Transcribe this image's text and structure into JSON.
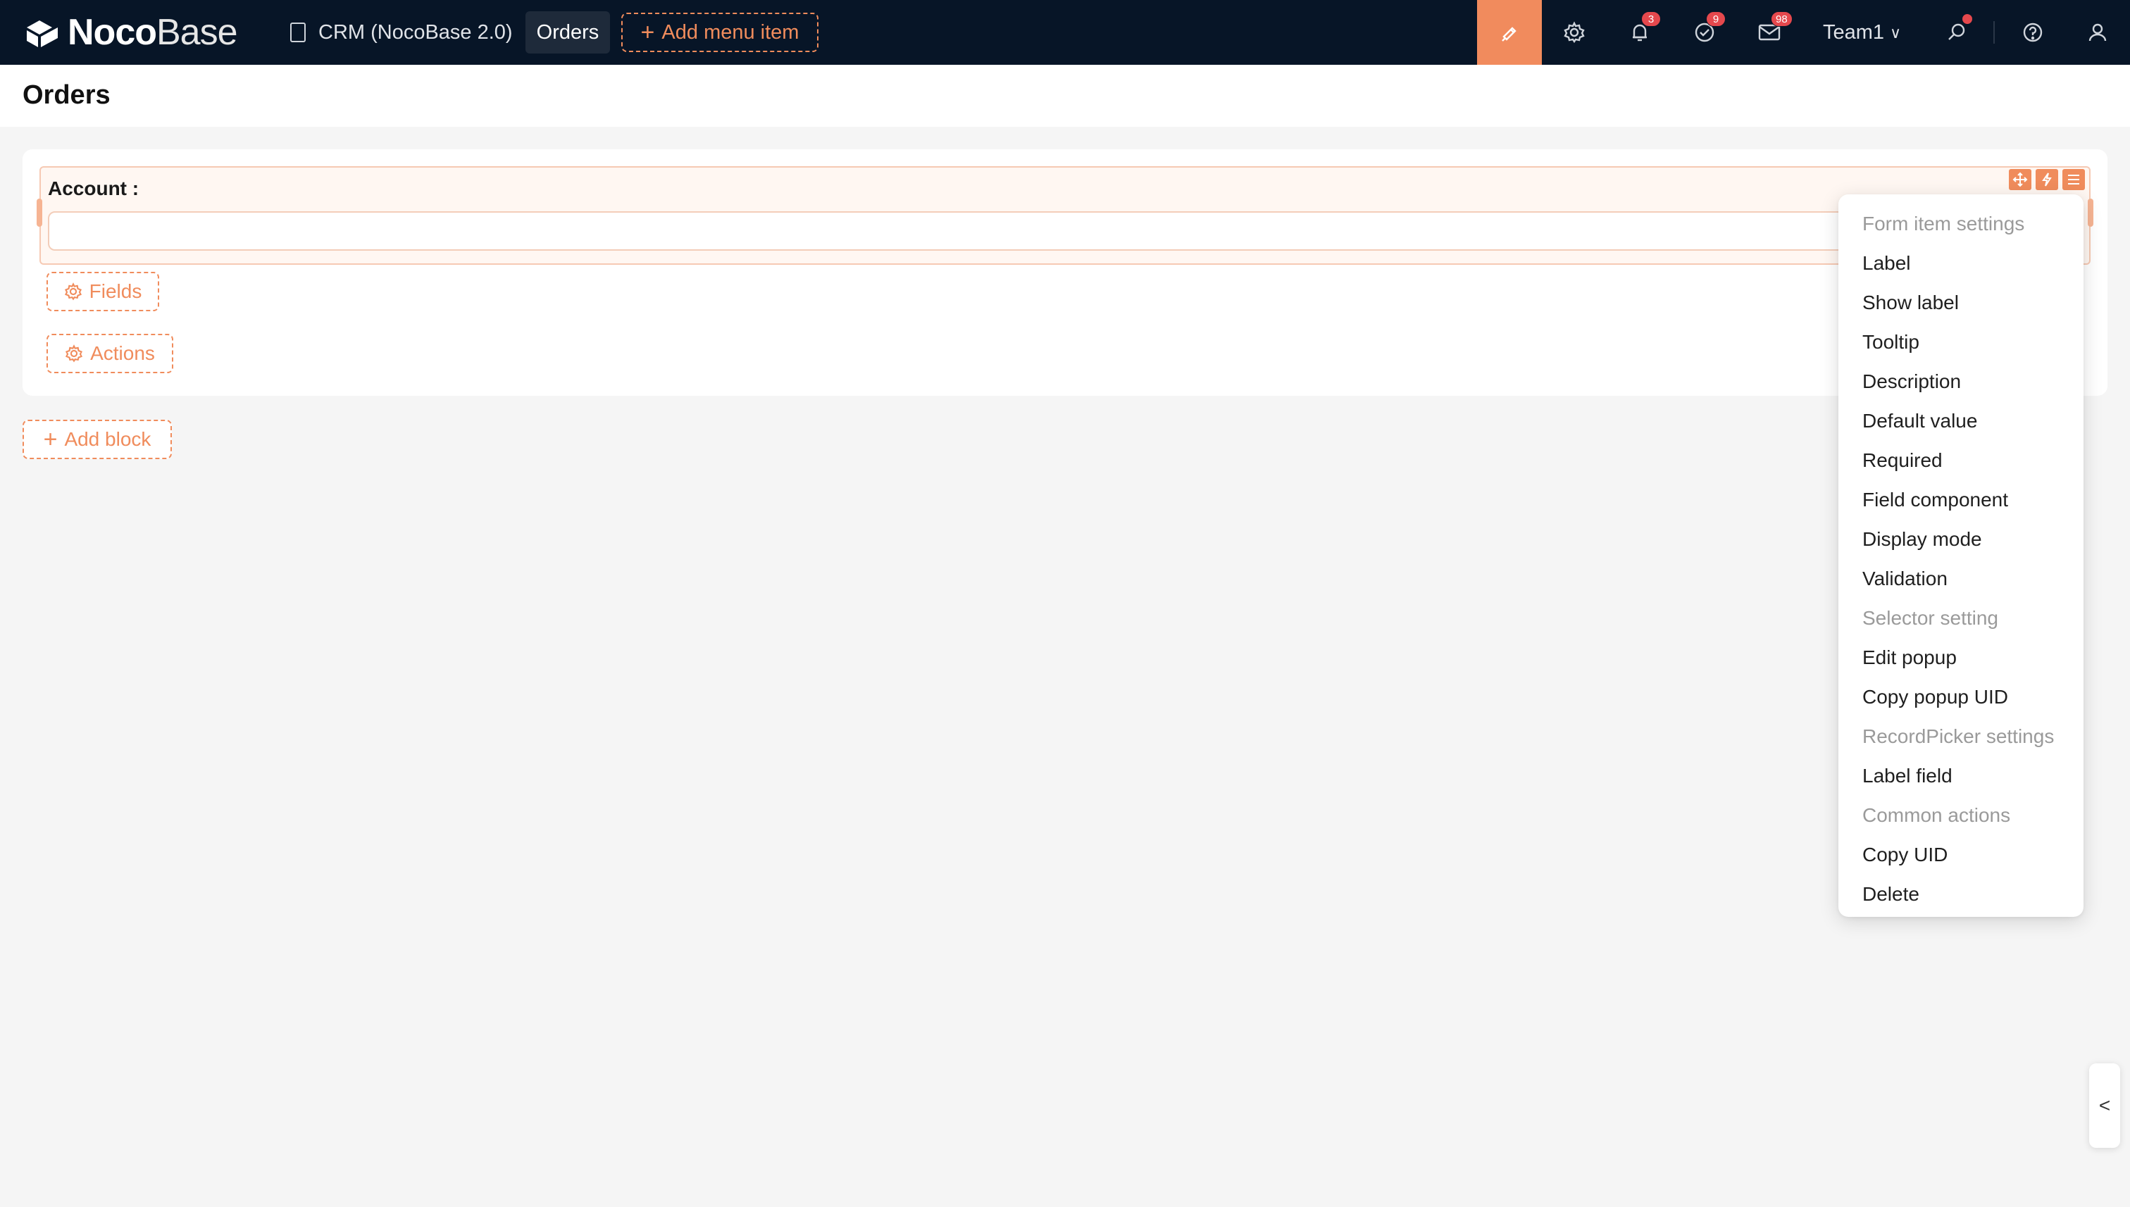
{
  "app": {
    "logo_bold": "Noco",
    "logo_light": "Base"
  },
  "topnav": {
    "crm_label": "CRM (NocoBase 2.0)",
    "orders_label": "Orders",
    "add_menu_label": "Add menu item",
    "team_label": "Team1",
    "badges": {
      "notifications": "3",
      "tasks": "9",
      "mail": "98"
    },
    "colors": {
      "bar": "#071527",
      "accent": "#f18b5d",
      "badge": "#e5484d"
    }
  },
  "page": {
    "title": "Orders"
  },
  "form": {
    "field_label": "Account :",
    "field_value": "",
    "fields_button": "Fields",
    "actions_button": "Actions"
  },
  "add_block_label": "Add block",
  "menu": {
    "items": [
      {
        "label": "Form item settings",
        "type": "group"
      },
      {
        "label": "Label",
        "type": "item"
      },
      {
        "label": "Show label",
        "type": "item"
      },
      {
        "label": "Tooltip",
        "type": "item"
      },
      {
        "label": "Description",
        "type": "item"
      },
      {
        "label": "Default value",
        "type": "item"
      },
      {
        "label": "Required",
        "type": "item"
      },
      {
        "label": "Field component",
        "type": "item"
      },
      {
        "label": "Display mode",
        "type": "item"
      },
      {
        "label": "Validation",
        "type": "item"
      },
      {
        "label": "Selector setting",
        "type": "group"
      },
      {
        "label": "Edit popup",
        "type": "item"
      },
      {
        "label": "Copy popup UID",
        "type": "item"
      },
      {
        "label": "RecordPicker settings",
        "type": "group"
      },
      {
        "label": "Label field",
        "type": "item"
      },
      {
        "label": "Common actions",
        "type": "group"
      },
      {
        "label": "Copy UID",
        "type": "item"
      },
      {
        "label": "Delete",
        "type": "item"
      }
    ]
  },
  "side_toggle": "<"
}
